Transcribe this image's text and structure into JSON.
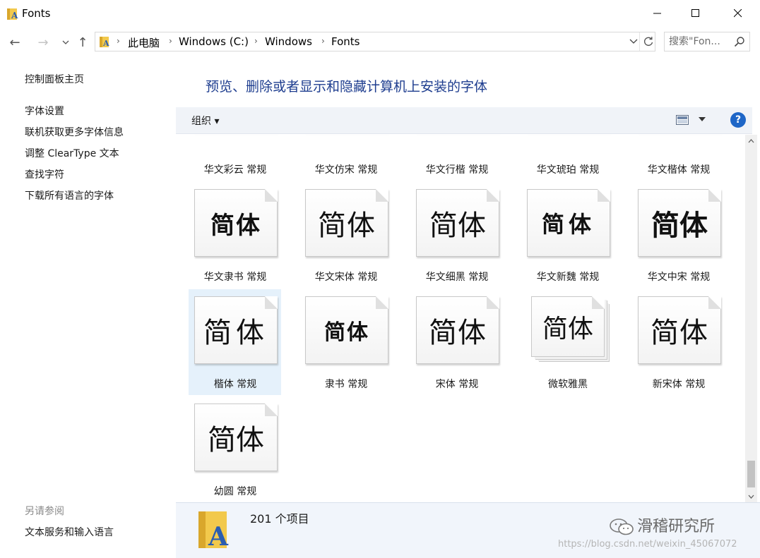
{
  "window": {
    "title": "Fonts"
  },
  "nav": {
    "back": "←",
    "forward": "→",
    "recent": "⌄",
    "up": "↑"
  },
  "address": {
    "crumbs": [
      "此电脑",
      "Windows (C:)",
      "Windows",
      "Fonts"
    ]
  },
  "search": {
    "placeholder": "搜索\"Fon..."
  },
  "left_pane": {
    "home": "控制面板主页",
    "links": [
      "字体设置",
      "联机获取更多字体信息",
      "调整 ClearType 文本",
      "查找字符",
      "下载所有语言的字体"
    ],
    "see_also_heading": "另请参阅",
    "see_also": [
      "文本服务和输入语言"
    ]
  },
  "main": {
    "title": "预览、删除或者显示和隐藏计算机上安装的字体"
  },
  "toolbar": {
    "organize": "组织 ▾",
    "help": "?"
  },
  "fonts_partial_row": [
    {
      "label": "华文彩云 常规"
    },
    {
      "label": "华文仿宋 常规"
    },
    {
      "label": "华文行楷 常规"
    },
    {
      "label": "华文琥珀 常规"
    },
    {
      "label": "华文楷体 常规"
    }
  ],
  "fonts": [
    {
      "label": "华文隶书 常规",
      "preview": "简体"
    },
    {
      "label": "华文宋体 常规",
      "preview": "简体"
    },
    {
      "label": "华文细黑 常规",
      "preview": "简体"
    },
    {
      "label": "华文新魏 常规",
      "preview": "简体"
    },
    {
      "label": "华文中宋 常规",
      "preview": "简体"
    },
    {
      "label": "楷体 常规",
      "preview": "简体"
    },
    {
      "label": "隶书 常规",
      "preview": "简体"
    },
    {
      "label": "宋体 常规",
      "preview": "简体"
    },
    {
      "label": "微软雅黑",
      "preview": "简体"
    },
    {
      "label": "新宋体 常规",
      "preview": "简体"
    },
    {
      "label": "幼圆 常规",
      "preview": "简体"
    }
  ],
  "details": {
    "count": "201 个项目"
  },
  "watermark": {
    "text": "滑稽研究所",
    "url": "https://blog.csdn.net/weixin_45067072"
  },
  "colors": {
    "accent": "#1e3d8f",
    "selected": "#e5f1fb",
    "help": "#1e66c7"
  }
}
